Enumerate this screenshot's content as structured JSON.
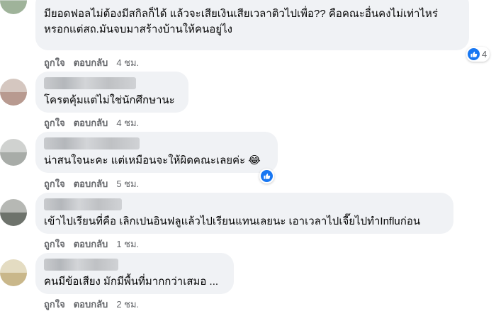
{
  "actions": {
    "like": "ถูกใจ",
    "reply": "ตอบกลับ"
  },
  "comments": [
    {
      "text": "มียอดฟอลไม่ต้องมีสกิลก็ได้ แล้วจะเสียเงินเสียเวลาติวไปเพื่อ?? คือคณะอื่นคงไม่เท่าไหร่\nหรอกแต่สถ.มันจบมาสร้างบ้านให้คนอยู่ไง",
      "time": "4 ชม.",
      "reactions": "4"
    },
    {
      "text": "โครตคุ้มแต่ไม่ใช่นักศึกษานะ",
      "time": "4 ชม."
    },
    {
      "text": "น่าสนใจนะคะ แต่เหมือนจะให้ผิดคณะเลยค่ะ 😂",
      "time": "5 ชม.",
      "reactions": ""
    },
    {
      "text": "เข้าไปเรียนที่คือ เลิกเปนอินฟลูแล้วไปเรียนแทนเลยนะ เอาเวลาไปเจี๊ยไปทำInfluก่อน",
      "time": "1 ชม."
    },
    {
      "text": "คนมีข้อเสียง มักมีพื้นที่มากกว่าเสมอ ...",
      "time": "2 ชม."
    }
  ],
  "colors": {
    "bubble": "#f0f2f5",
    "meta_text": "#65676b",
    "like_blue": "#1877f2"
  },
  "icons": {
    "like": "like-icon"
  }
}
